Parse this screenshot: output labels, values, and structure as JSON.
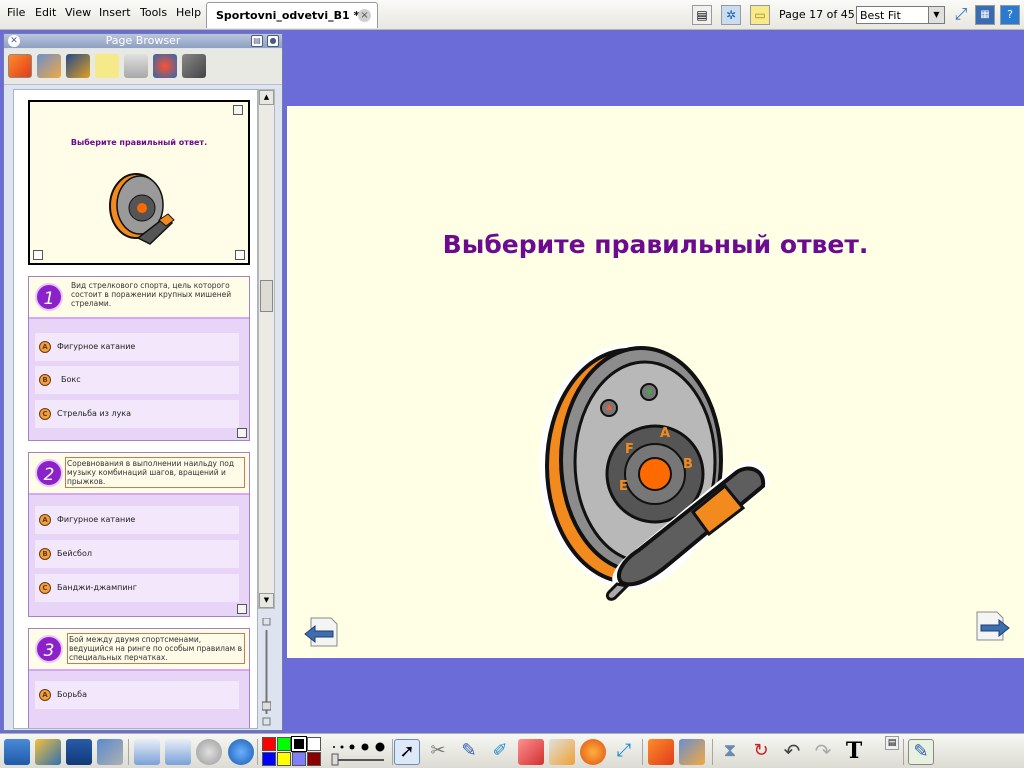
{
  "menu": [
    "File",
    "Edit",
    "View",
    "Insert",
    "Tools",
    "Help"
  ],
  "tab": {
    "label": "Sportovni_odvetvi_B1 *",
    "close": "×"
  },
  "toolbar": {
    "page_indicator": "Page 17 of 45",
    "zoom": "Best Fit"
  },
  "panel": {
    "title": "Page Browser"
  },
  "thumb1": {
    "title": "Выберите правильный ответ."
  },
  "questions": [
    {
      "num": "1",
      "text": "Вид стрелкового спорта, цель которого состоит  в поражении крупных мишеней стрелами.",
      "answers": [
        {
          "letter": "A",
          "text": "Фигурное катание"
        },
        {
          "letter": "B",
          "text": "Бокс"
        },
        {
          "letter": "C",
          "text": "Стрельба из лука"
        }
      ]
    },
    {
      "num": "2",
      "text": "Соревнования в выполнении наильду под музыку комбинаций шагов, вращений и прыжков.",
      "answers": [
        {
          "letter": "A",
          "text": "Фигурное катание"
        },
        {
          "letter": "B",
          "text": "Бейсбол"
        },
        {
          "letter": "C",
          "text": "Банджи-джампинг"
        }
      ]
    },
    {
      "num": "3",
      "text": "Бой между двумя спортсменами, ведущийся на ринге по особым правилам в специальных перчатках.",
      "answers": [
        {
          "letter": "A",
          "text": "Борьба"
        }
      ]
    }
  ],
  "slide": {
    "title": "Выберите правильный ответ."
  },
  "colors": {
    "accent_purple": "#6c0b90",
    "canvas_bg": "#ffffe6",
    "workspace": "#6c6cd9"
  },
  "palette": [
    "#ff0000",
    "#00ff00",
    "#000000",
    "#ffffff",
    "#0000ff",
    "#ffff00",
    "#8080ff",
    "#880000"
  ]
}
